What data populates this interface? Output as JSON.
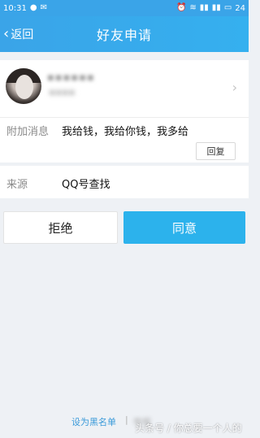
{
  "status_bar": {
    "time": "10:31",
    "battery": "24"
  },
  "header": {
    "back_label": "返回",
    "title": "好友申请"
  },
  "profile": {
    "name_obscured": "▪▪▪▪▪▪",
    "sub_obscured": "▪▪▪▪"
  },
  "request": {
    "message_label": "附加消息",
    "message_text": "我给钱，我给你钱，我多给",
    "reply_label": "回复",
    "source_label": "来源",
    "source_value": "QQ号查找"
  },
  "actions": {
    "reject_label": "拒绝",
    "accept_label": "同意"
  },
  "footer": {
    "blacklist_label": "设为黑名单",
    "divider": "|",
    "report_obscured": "举报"
  },
  "watermark": {
    "text": "头条号 / 你总要一个人的"
  },
  "colors": {
    "header_bg": "#3aa4e8",
    "accept_bg": "#2cb2ec",
    "link": "#3a9ad9",
    "page_bg": "#eef1f5"
  }
}
